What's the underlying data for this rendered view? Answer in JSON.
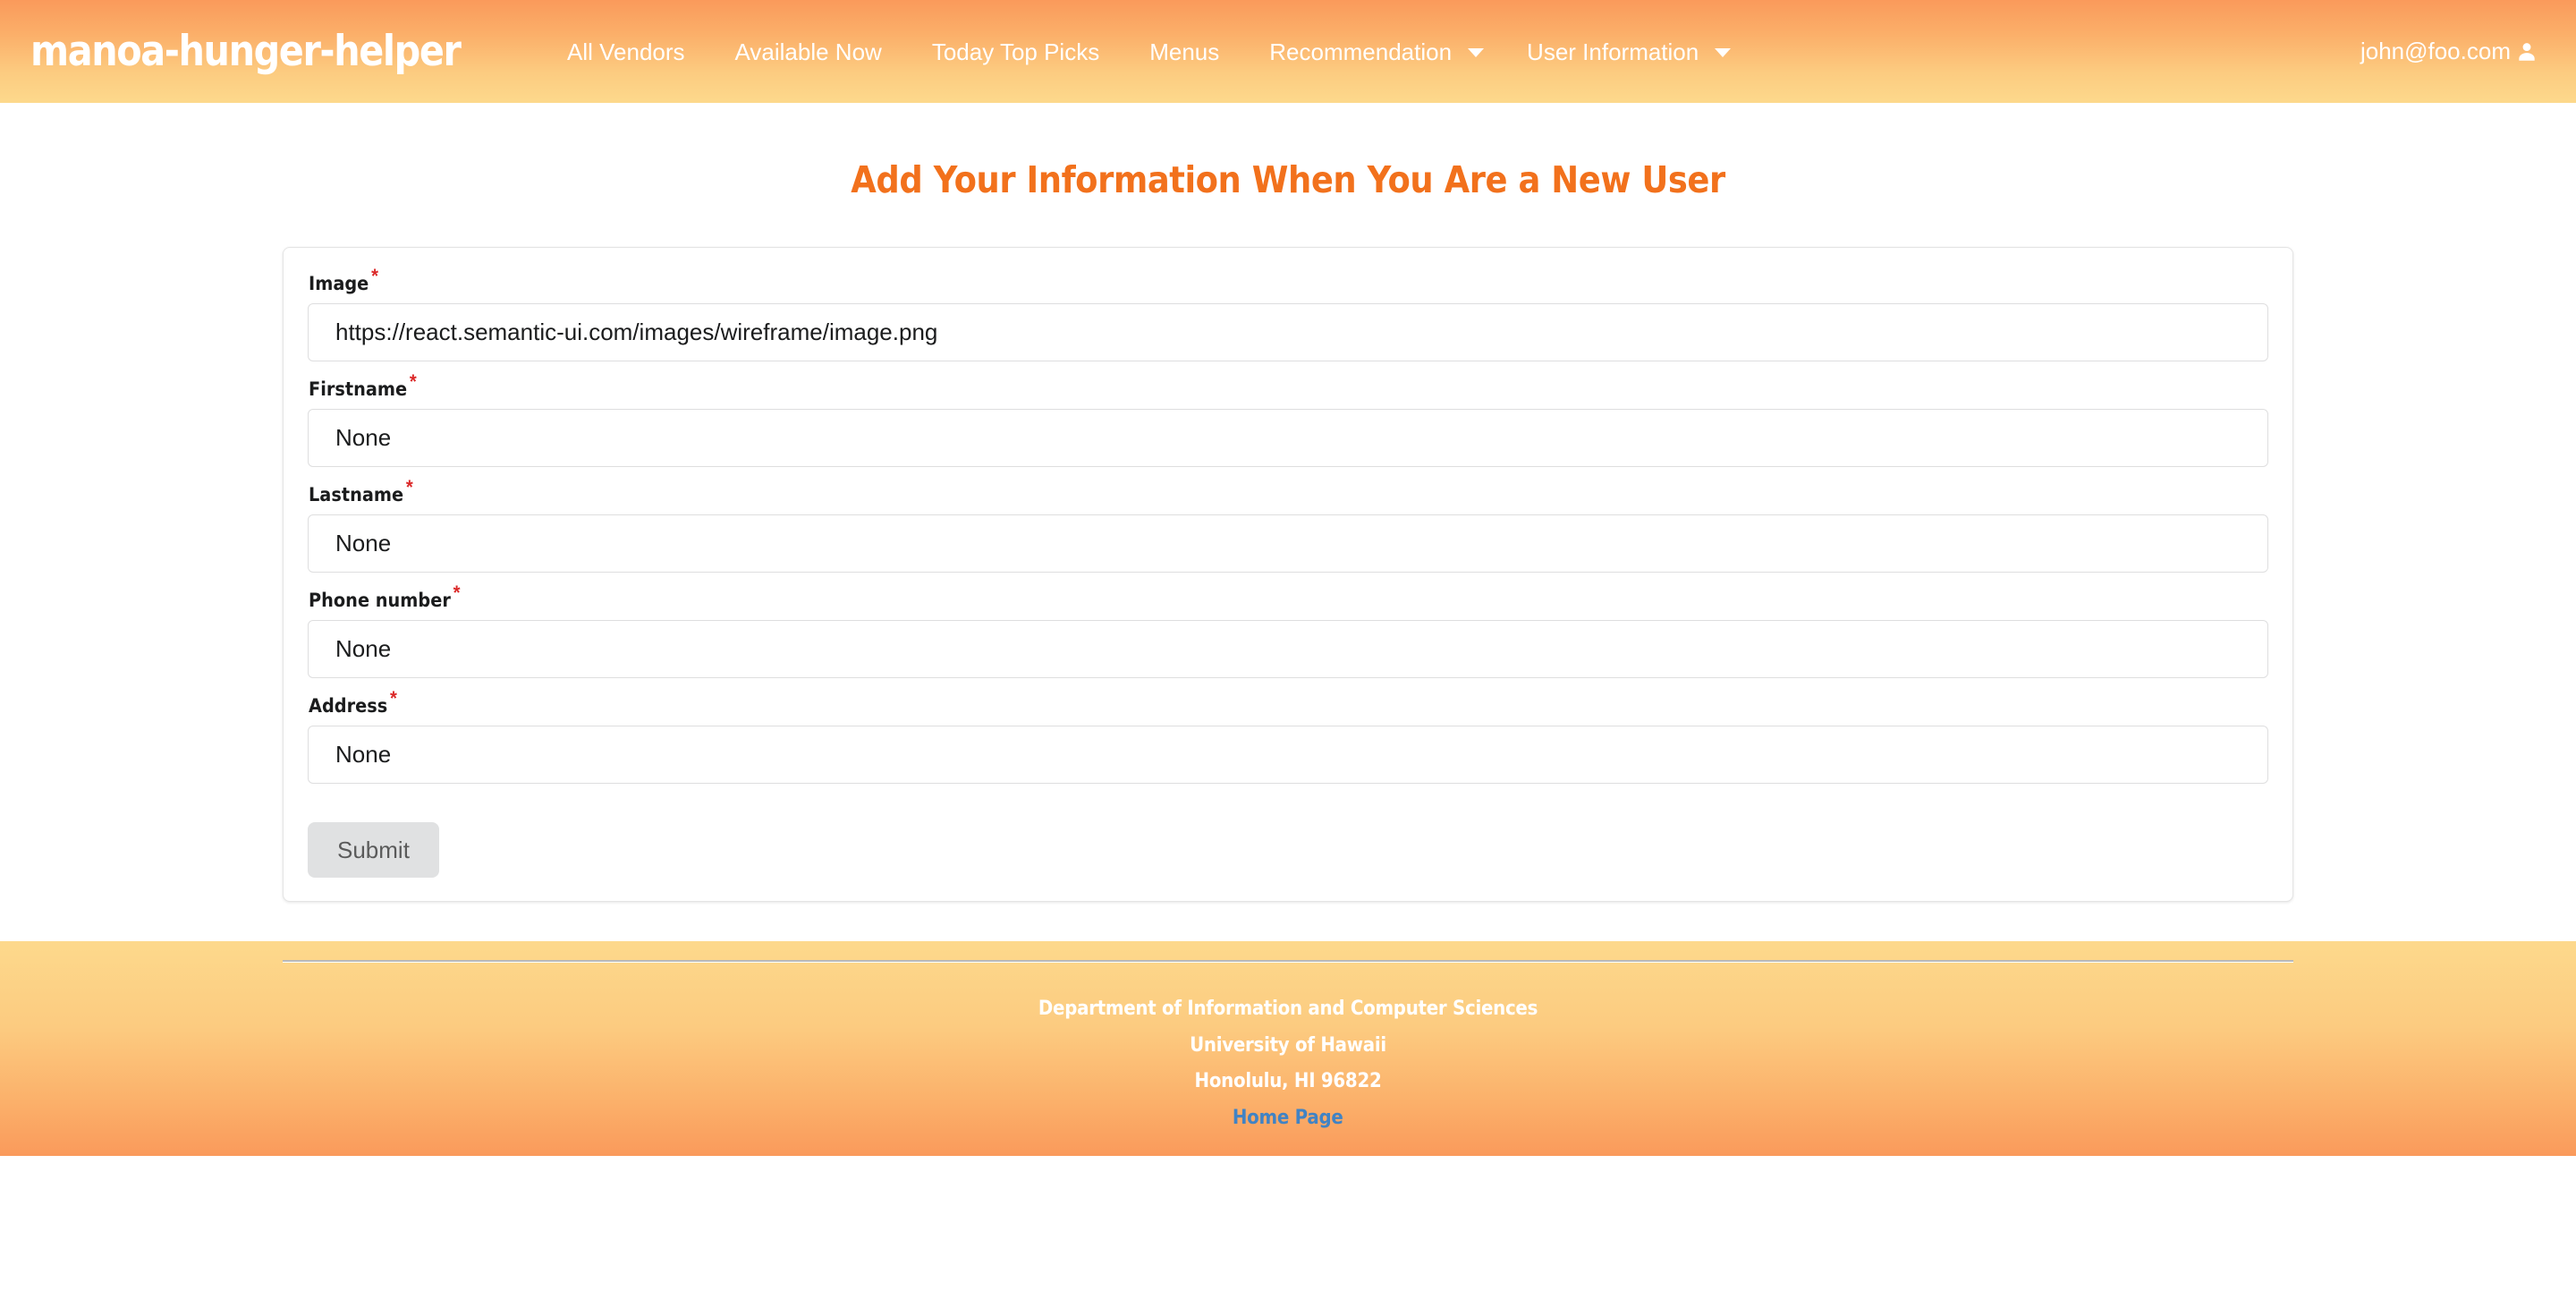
{
  "navbar": {
    "brand": "manoa-hunger-helper",
    "links": [
      {
        "label": "All Vendors",
        "has_caret": false
      },
      {
        "label": "Available Now",
        "has_caret": false
      },
      {
        "label": "Today Top Picks",
        "has_caret": false
      },
      {
        "label": "Menus",
        "has_caret": false
      },
      {
        "label": "Recommendation",
        "has_caret": true
      },
      {
        "label": "User Information",
        "has_caret": true
      }
    ],
    "user_email": "john@foo.com",
    "user_icon": "user-icon",
    "gradient_top": "#fa9a5b",
    "gradient_bottom": "#fdd98c"
  },
  "page": {
    "title": "Add Your Information When You Are a New User",
    "title_color": "#f2711c"
  },
  "form": {
    "required_marker": "*",
    "fields": [
      {
        "label": "Image",
        "required": true,
        "value": "https://react.semantic-ui.com/images/wireframe/image.png",
        "placeholder": "Image"
      },
      {
        "label": "Firstname",
        "required": true,
        "value": "None",
        "placeholder": "Firstname"
      },
      {
        "label": "Lastname",
        "required": true,
        "value": "None",
        "placeholder": "Lastname"
      },
      {
        "label": "Phone number",
        "required": true,
        "value": "None",
        "placeholder": "Phone number"
      },
      {
        "label": "Address",
        "required": true,
        "value": "None",
        "placeholder": "Address"
      }
    ],
    "submit_label": "Submit",
    "submit_bg": "#e0e1e2"
  },
  "footer": {
    "lines": [
      "Department of Information and Computer Sciences",
      "University of Hawaii",
      "Honolulu, HI 96822"
    ],
    "link_label": "Home Page",
    "link_color": "#4183c4",
    "gradient_top": "#fdd98c",
    "gradient_bottom": "#fa9a5b"
  }
}
